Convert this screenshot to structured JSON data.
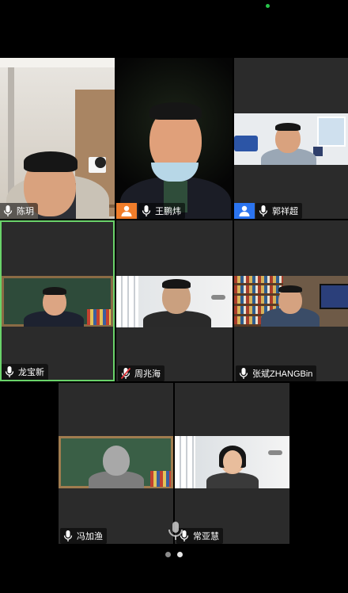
{
  "participants": [
    {
      "name": "陈玥",
      "muted": false
    },
    {
      "name": "王鹏炜",
      "muted": false,
      "avatar": "person-icon",
      "avatar_color": "#f07d2b"
    },
    {
      "name": "郭祥超",
      "muted": false,
      "avatar": "person-icon",
      "avatar_color": "#2b74f0"
    },
    {
      "name": "龙宝新",
      "muted": false,
      "active_speaker": true
    },
    {
      "name": "周兆海",
      "muted": true
    },
    {
      "name": "张斌ZHANGBin",
      "muted": false
    },
    {
      "name": "冯加渔",
      "muted": false
    },
    {
      "name": "常亚慧",
      "muted": false
    }
  ],
  "pager": {
    "pages": 2,
    "current": 2
  },
  "colors": {
    "active_border": "#6ad36a",
    "tile_bg": "#2b2b2b",
    "status_dot": "#27c44a"
  }
}
